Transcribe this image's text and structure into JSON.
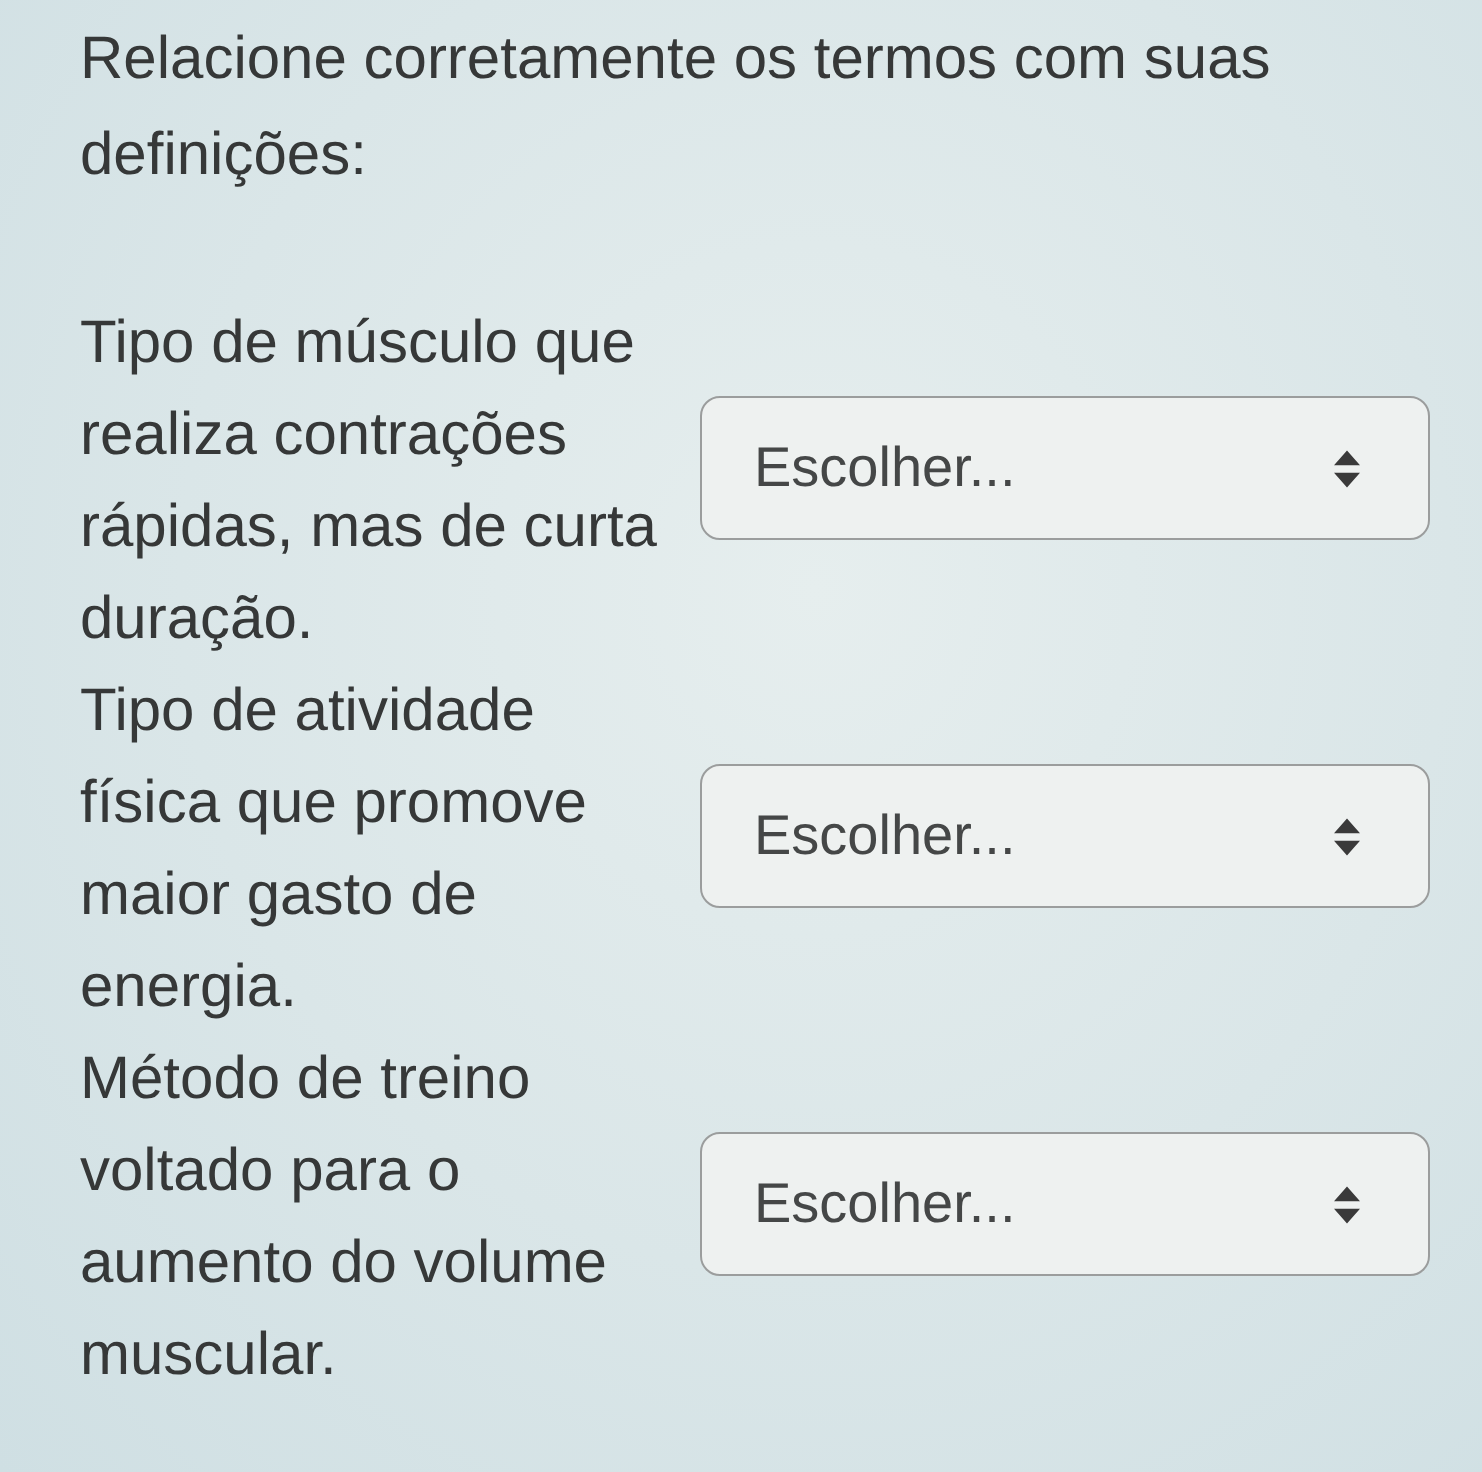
{
  "question": {
    "prompt": "Relacione corretamente os termos com suas definições:"
  },
  "matches": [
    {
      "definition": "Tipo de músculo que realiza contrações rápidas, mas de curta duração.",
      "dropdown": {
        "value": "Escolher..."
      }
    },
    {
      "definition": "Tipo de atividade física que promove maior gasto de energia.",
      "dropdown": {
        "value": "Escolher..."
      }
    },
    {
      "definition": "Método de treino voltado para o aumento do volume muscular.",
      "dropdown": {
        "value": "Escolher..."
      }
    }
  ]
}
